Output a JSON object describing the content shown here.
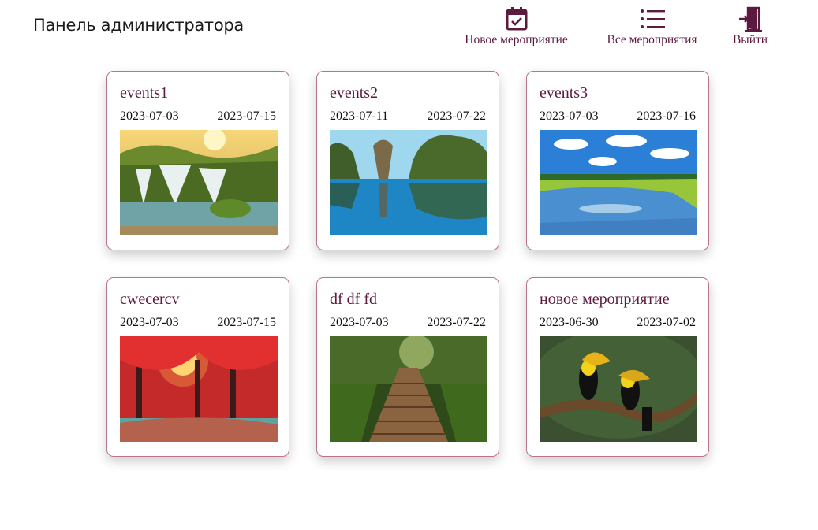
{
  "header": {
    "title": "Панель администратора",
    "nav": [
      {
        "label": "Новое мероприятие",
        "icon": "calendar-check-icon"
      },
      {
        "label": "Все мероприятия",
        "icon": "list-icon"
      },
      {
        "label": "Выйти",
        "icon": "exit-door-icon"
      }
    ]
  },
  "colors": {
    "accent": "#5c1a3f",
    "card_border": "#b8748f"
  },
  "events": [
    {
      "title": "events1",
      "start": "2023-07-03",
      "end": "2023-07-15",
      "image": "waterfall-image"
    },
    {
      "title": "events2",
      "start": "2023-07-11",
      "end": "2023-07-22",
      "image": "tropical-rocks-image"
    },
    {
      "title": "events3",
      "start": "2023-07-03",
      "end": "2023-07-16",
      "image": "river-landscape-image"
    },
    {
      "title": "cwecercv",
      "start": "2023-07-03",
      "end": "2023-07-15",
      "image": "red-forest-image"
    },
    {
      "title": "df df fd",
      "start": "2023-07-03",
      "end": "2023-07-22",
      "image": "forest-path-image"
    },
    {
      "title": "новое мероприятие",
      "start": "2023-06-30",
      "end": "2023-07-02",
      "image": "toucans-image"
    }
  ]
}
